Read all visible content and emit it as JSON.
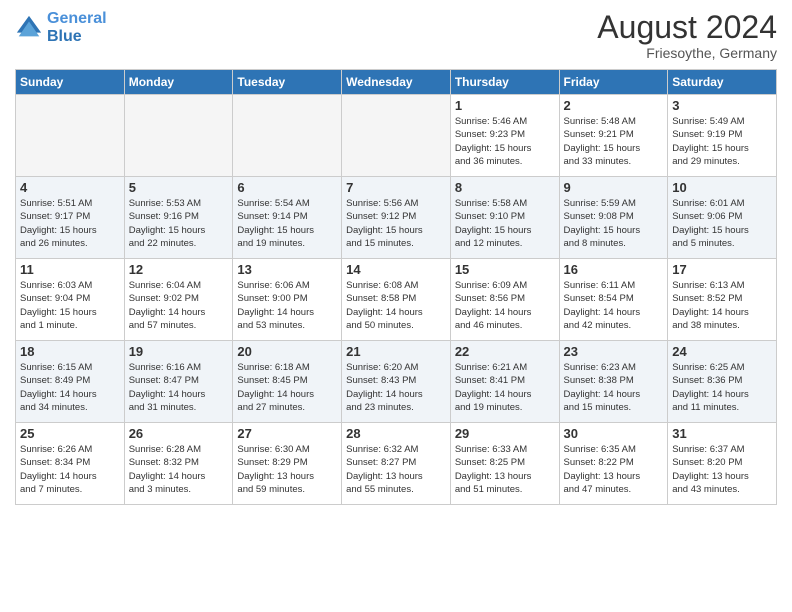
{
  "logo": {
    "line1": "General",
    "line2": "Blue"
  },
  "header": {
    "month": "August 2024",
    "location": "Friesoythe, Germany"
  },
  "weekdays": [
    "Sunday",
    "Monday",
    "Tuesday",
    "Wednesday",
    "Thursday",
    "Friday",
    "Saturday"
  ],
  "weeks": [
    [
      {
        "day": "",
        "info": ""
      },
      {
        "day": "",
        "info": ""
      },
      {
        "day": "",
        "info": ""
      },
      {
        "day": "",
        "info": ""
      },
      {
        "day": "1",
        "info": "Sunrise: 5:46 AM\nSunset: 9:23 PM\nDaylight: 15 hours\nand 36 minutes."
      },
      {
        "day": "2",
        "info": "Sunrise: 5:48 AM\nSunset: 9:21 PM\nDaylight: 15 hours\nand 33 minutes."
      },
      {
        "day": "3",
        "info": "Sunrise: 5:49 AM\nSunset: 9:19 PM\nDaylight: 15 hours\nand 29 minutes."
      }
    ],
    [
      {
        "day": "4",
        "info": "Sunrise: 5:51 AM\nSunset: 9:17 PM\nDaylight: 15 hours\nand 26 minutes."
      },
      {
        "day": "5",
        "info": "Sunrise: 5:53 AM\nSunset: 9:16 PM\nDaylight: 15 hours\nand 22 minutes."
      },
      {
        "day": "6",
        "info": "Sunrise: 5:54 AM\nSunset: 9:14 PM\nDaylight: 15 hours\nand 19 minutes."
      },
      {
        "day": "7",
        "info": "Sunrise: 5:56 AM\nSunset: 9:12 PM\nDaylight: 15 hours\nand 15 minutes."
      },
      {
        "day": "8",
        "info": "Sunrise: 5:58 AM\nSunset: 9:10 PM\nDaylight: 15 hours\nand 12 minutes."
      },
      {
        "day": "9",
        "info": "Sunrise: 5:59 AM\nSunset: 9:08 PM\nDaylight: 15 hours\nand 8 minutes."
      },
      {
        "day": "10",
        "info": "Sunrise: 6:01 AM\nSunset: 9:06 PM\nDaylight: 15 hours\nand 5 minutes."
      }
    ],
    [
      {
        "day": "11",
        "info": "Sunrise: 6:03 AM\nSunset: 9:04 PM\nDaylight: 15 hours\nand 1 minute."
      },
      {
        "day": "12",
        "info": "Sunrise: 6:04 AM\nSunset: 9:02 PM\nDaylight: 14 hours\nand 57 minutes."
      },
      {
        "day": "13",
        "info": "Sunrise: 6:06 AM\nSunset: 9:00 PM\nDaylight: 14 hours\nand 53 minutes."
      },
      {
        "day": "14",
        "info": "Sunrise: 6:08 AM\nSunset: 8:58 PM\nDaylight: 14 hours\nand 50 minutes."
      },
      {
        "day": "15",
        "info": "Sunrise: 6:09 AM\nSunset: 8:56 PM\nDaylight: 14 hours\nand 46 minutes."
      },
      {
        "day": "16",
        "info": "Sunrise: 6:11 AM\nSunset: 8:54 PM\nDaylight: 14 hours\nand 42 minutes."
      },
      {
        "day": "17",
        "info": "Sunrise: 6:13 AM\nSunset: 8:52 PM\nDaylight: 14 hours\nand 38 minutes."
      }
    ],
    [
      {
        "day": "18",
        "info": "Sunrise: 6:15 AM\nSunset: 8:49 PM\nDaylight: 14 hours\nand 34 minutes."
      },
      {
        "day": "19",
        "info": "Sunrise: 6:16 AM\nSunset: 8:47 PM\nDaylight: 14 hours\nand 31 minutes."
      },
      {
        "day": "20",
        "info": "Sunrise: 6:18 AM\nSunset: 8:45 PM\nDaylight: 14 hours\nand 27 minutes."
      },
      {
        "day": "21",
        "info": "Sunrise: 6:20 AM\nSunset: 8:43 PM\nDaylight: 14 hours\nand 23 minutes."
      },
      {
        "day": "22",
        "info": "Sunrise: 6:21 AM\nSunset: 8:41 PM\nDaylight: 14 hours\nand 19 minutes."
      },
      {
        "day": "23",
        "info": "Sunrise: 6:23 AM\nSunset: 8:38 PM\nDaylight: 14 hours\nand 15 minutes."
      },
      {
        "day": "24",
        "info": "Sunrise: 6:25 AM\nSunset: 8:36 PM\nDaylight: 14 hours\nand 11 minutes."
      }
    ],
    [
      {
        "day": "25",
        "info": "Sunrise: 6:26 AM\nSunset: 8:34 PM\nDaylight: 14 hours\nand 7 minutes."
      },
      {
        "day": "26",
        "info": "Sunrise: 6:28 AM\nSunset: 8:32 PM\nDaylight: 14 hours\nand 3 minutes."
      },
      {
        "day": "27",
        "info": "Sunrise: 6:30 AM\nSunset: 8:29 PM\nDaylight: 13 hours\nand 59 minutes."
      },
      {
        "day": "28",
        "info": "Sunrise: 6:32 AM\nSunset: 8:27 PM\nDaylight: 13 hours\nand 55 minutes."
      },
      {
        "day": "29",
        "info": "Sunrise: 6:33 AM\nSunset: 8:25 PM\nDaylight: 13 hours\nand 51 minutes."
      },
      {
        "day": "30",
        "info": "Sunrise: 6:35 AM\nSunset: 8:22 PM\nDaylight: 13 hours\nand 47 minutes."
      },
      {
        "day": "31",
        "info": "Sunrise: 6:37 AM\nSunset: 8:20 PM\nDaylight: 13 hours\nand 43 minutes."
      }
    ]
  ]
}
